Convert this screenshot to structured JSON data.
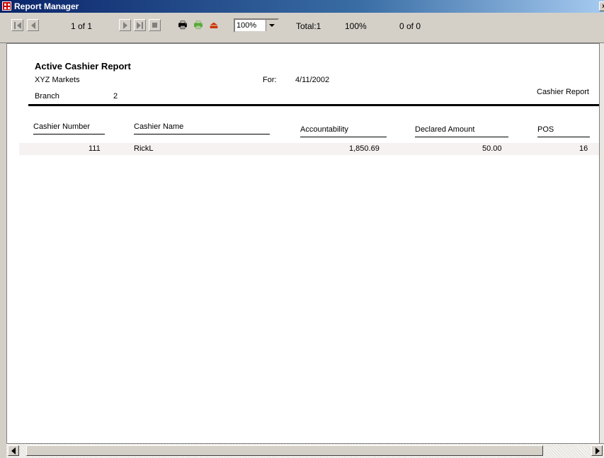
{
  "window": {
    "title": "Report Manager",
    "close_glyph": "×"
  },
  "toolbar": {
    "page_info": "1 of 1",
    "zoom": "100%",
    "total": "Total:1",
    "percent": "100%",
    "match_count": "0 of 0"
  },
  "report": {
    "title": "Active Cashier Report",
    "company": "XYZ Markets",
    "for_label": "For:",
    "for_date": "4/11/2002",
    "branch_label": "Branch",
    "branch_value": "2",
    "report_type": "Cashier Report",
    "columns": [
      "Cashier Number",
      "Cashier Name",
      "Accountability",
      "Declared Amount",
      "POS"
    ],
    "rows": [
      {
        "cashier_number": "111",
        "cashier_name": "RickL",
        "accountability": "1,850.69",
        "declared_amount": "50.00",
        "pos": "16"
      }
    ]
  },
  "colors": {
    "title_bar": "#0a246a",
    "row_highlight": "#f7f2f2"
  }
}
